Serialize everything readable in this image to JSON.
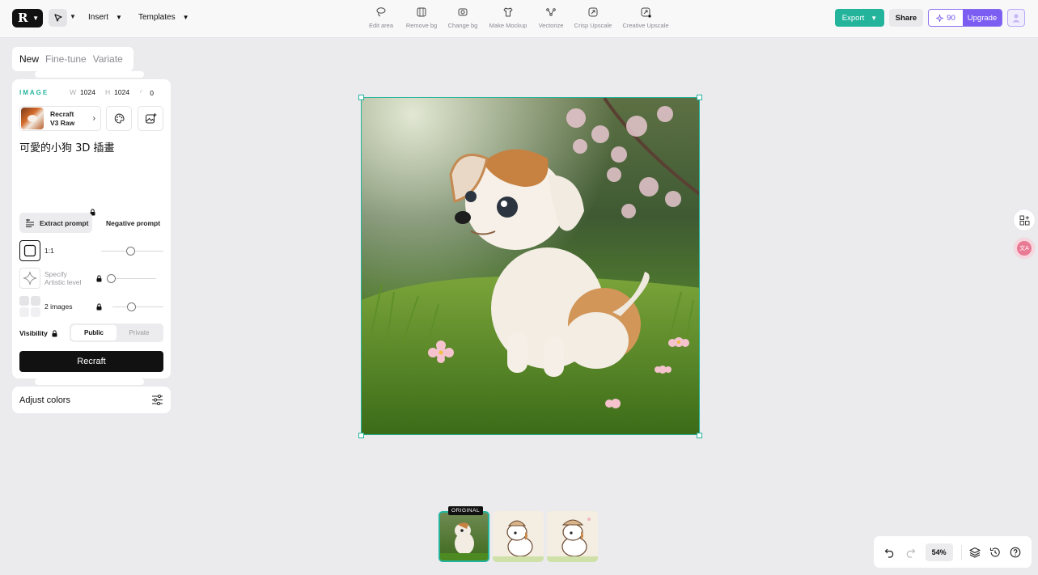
{
  "topbar": {
    "insert_label": "Insert",
    "templates_label": "Templates",
    "actions": [
      {
        "label": "Edit area",
        "icon": "lasso-icon"
      },
      {
        "label": "Remove bg",
        "icon": "remove-bg-icon"
      },
      {
        "label": "Change bg",
        "icon": "change-bg-icon"
      },
      {
        "label": "Make Mockup",
        "icon": "tshirt-icon"
      },
      {
        "label": "Vectorize",
        "icon": "vector-nodes-icon"
      },
      {
        "label": "Crisp Upscale",
        "icon": "upscale-icon"
      },
      {
        "label": "Creative Upscale",
        "icon": "creative-upscale-icon"
      }
    ],
    "export_label": "Export",
    "share_label": "Share",
    "credits": "90",
    "upgrade_label": "Upgrade"
  },
  "left_panel": {
    "tabs": [
      "New",
      "Fine-tune",
      "Variate"
    ],
    "image_label": "IMAGE",
    "width_key": "W",
    "width_value": "1024",
    "height_key": "H",
    "height_value": "1024",
    "seed_value": "0",
    "model_line1": "Recraft",
    "model_line2": "V3 Raw",
    "prompt": "可愛的小狗 3D 插畫",
    "extract_prompt_label": "Extract prompt",
    "negative_prompt_label": "Negative prompt",
    "aspect_label": "1:1",
    "artistic_line1": "Specify",
    "artistic_line2": "Artistic level",
    "images_label": "2 images",
    "visibility_label": "Visibility",
    "public_label": "Public",
    "private_label": "Private",
    "recraft_button": "Recraft",
    "adjust_colors_label": "Adjust colors"
  },
  "thumbnails": {
    "original_tag": "ORIGINAL"
  },
  "bottombar": {
    "zoom": "54%"
  },
  "colors": {
    "accent": "#24b49c",
    "upgrade": "#7b5df2",
    "background": "#ebebee"
  }
}
